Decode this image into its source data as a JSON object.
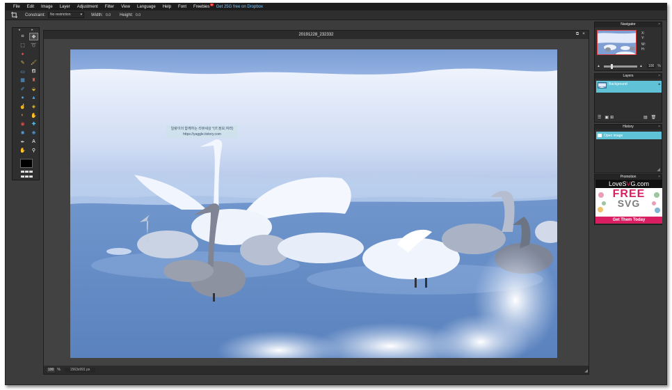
{
  "menubar": {
    "items": [
      "File",
      "Edit",
      "Image",
      "Layer",
      "Adjustment",
      "Filter",
      "View",
      "Language",
      "Help",
      "Font",
      "Freebies"
    ],
    "freebies_badge": "5",
    "dropbox_link": "Get 25G free on Dropbox"
  },
  "options": {
    "constraint_label": "Constraint:",
    "constraint_value": "No restriction",
    "width_label": "Width:",
    "width_value": "0.0",
    "height_label": "Height:",
    "height_value": "0.0"
  },
  "tools": {
    "icons": [
      "crop-icon",
      "move-icon",
      "marquee-icon",
      "lasso-icon",
      "magic-wand-icon",
      "blank",
      "pencil-icon",
      "brush-icon",
      "eraser-icon",
      "bucket-icon",
      "gradient-icon",
      "clone-stamp-icon",
      "colorize-icon",
      "drawing-icon",
      "blur-icon",
      "sharpen-icon",
      "smudge-icon",
      "sponge-icon",
      "dodge-icon",
      "burn-icon",
      "red-eye-icon",
      "spot-heal-icon",
      "bloat-icon",
      "pinch-icon",
      "color-picker-icon",
      "type-icon",
      "hand-icon",
      "zoom-icon"
    ],
    "active_index": 1,
    "foreground_color": "#000000"
  },
  "document": {
    "title": "20191228_232332",
    "zoom": "100",
    "zoom_pct": "%",
    "dimensions": "1563x991 px",
    "watermark_line1": "일랑이의 함께하는 리뷰세상 *(IT,정보,여러)",
    "watermark_line2": "https://yaggle.tistory.com"
  },
  "navigator": {
    "title": "Navigator",
    "x_label": "X:",
    "y_label": "Y:",
    "w_label": "W:",
    "h_label": "H:",
    "zoom_value": "100",
    "zoom_pct": "%"
  },
  "layers": {
    "title": "Layers",
    "items": [
      {
        "name": "Background"
      }
    ]
  },
  "history": {
    "title": "History",
    "items": [
      {
        "name": "Open image"
      }
    ]
  },
  "promotion": {
    "title": "Promotion",
    "logo_prefix": "LoveS",
    "logo_accent": "V",
    "logo_suffix": "G.com",
    "headline": "FREE",
    "subhead": "SVG",
    "cta": "Get Them Today"
  },
  "colors": {
    "accent": "#5fc2d6",
    "promo": "#d91e62",
    "link": "#7ec8ff"
  }
}
